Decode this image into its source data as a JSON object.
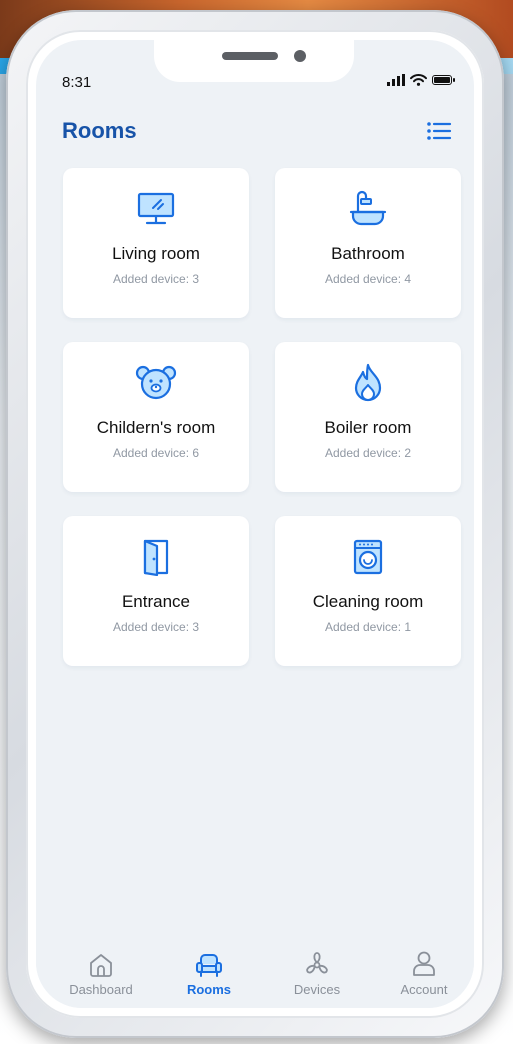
{
  "status_bar": {
    "time": "8:31"
  },
  "header": {
    "title": "Rooms",
    "menu_icon": "list-menu-icon"
  },
  "rooms": [
    {
      "name": "Living room",
      "subtitle": "Added device: 3",
      "icon": "monitor-icon"
    },
    {
      "name": "Bathroom",
      "subtitle": "Added device: 4",
      "icon": "bathtub-icon"
    },
    {
      "name": "Childern's room",
      "subtitle": "Added device: 6",
      "icon": "teddy-bear-icon"
    },
    {
      "name": "Boiler room",
      "subtitle": "Added device: 2",
      "icon": "flame-icon"
    },
    {
      "name": "Entrance",
      "subtitle": "Added device: 3",
      "icon": "door-icon"
    },
    {
      "name": "Cleaning room",
      "subtitle": "Added device: 1",
      "icon": "washing-machine-icon"
    }
  ],
  "bottom_nav": {
    "items": [
      {
        "label": "Dashboard",
        "icon": "home-icon",
        "active": false
      },
      {
        "label": "Rooms",
        "icon": "armchair-icon",
        "active": true
      },
      {
        "label": "Devices",
        "icon": "fan-icon",
        "active": false
      },
      {
        "label": "Account",
        "icon": "user-icon",
        "active": false
      }
    ]
  },
  "colors": {
    "accent": "#1b6fe0",
    "title": "#1753a8",
    "background": "#eef2f6",
    "card": "#ffffff"
  }
}
